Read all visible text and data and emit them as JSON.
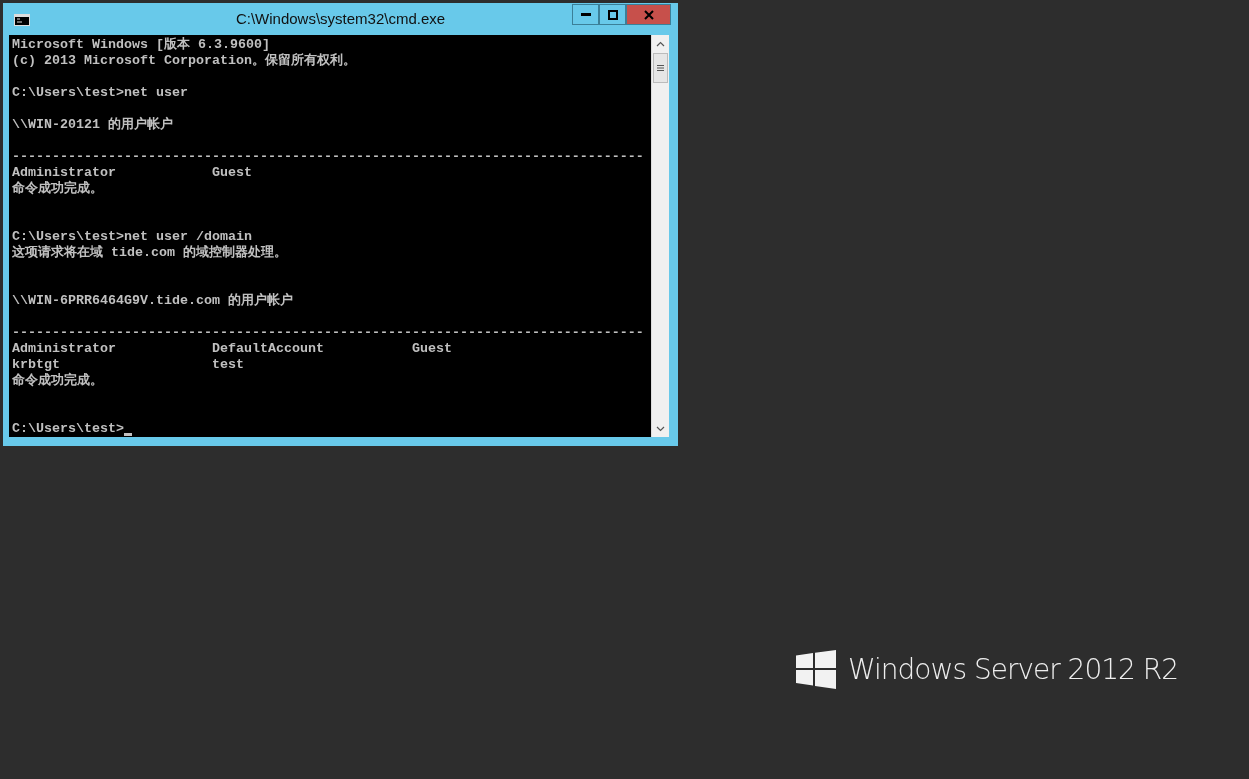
{
  "window": {
    "title": "C:\\Windows\\system32\\cmd.exe"
  },
  "console": {
    "lines": [
      {
        "kind": "text",
        "text": "Microsoft Windows [版本 6.3.9600]"
      },
      {
        "kind": "text",
        "text": "(c) 2013 Microsoft Corporation。保留所有权利。"
      },
      {
        "kind": "blank"
      },
      {
        "kind": "text",
        "text": "C:\\Users\\test>net user"
      },
      {
        "kind": "blank"
      },
      {
        "kind": "text",
        "text": "\\\\WIN-20121 的用户帐户"
      },
      {
        "kind": "blank"
      },
      {
        "kind": "text",
        "text": "-------------------------------------------------------------------------------"
      },
      {
        "kind": "text",
        "text": "Administrator            Guest"
      },
      {
        "kind": "text",
        "text": "命令成功完成。"
      },
      {
        "kind": "blank"
      },
      {
        "kind": "blank"
      },
      {
        "kind": "text",
        "text": "C:\\Users\\test>net user /domain"
      },
      {
        "kind": "text",
        "text": "这项请求将在域 tide.com 的域控制器处理。"
      },
      {
        "kind": "blank"
      },
      {
        "kind": "blank"
      },
      {
        "kind": "text",
        "text": "\\\\WIN-6PRR6464G9V.tide.com 的用户帐户"
      },
      {
        "kind": "blank"
      },
      {
        "kind": "text",
        "text": "-------------------------------------------------------------------------------"
      },
      {
        "kind": "text",
        "text": "Administrator            DefaultAccount           Guest"
      },
      {
        "kind": "text",
        "text": "krbtgt                   test"
      },
      {
        "kind": "text",
        "text": "命令成功完成。"
      },
      {
        "kind": "blank"
      },
      {
        "kind": "blank"
      },
      {
        "kind": "prompt",
        "text": "C:\\Users\\test>"
      }
    ]
  },
  "desktop": {
    "brand": "Windows Server 2012 R2"
  }
}
